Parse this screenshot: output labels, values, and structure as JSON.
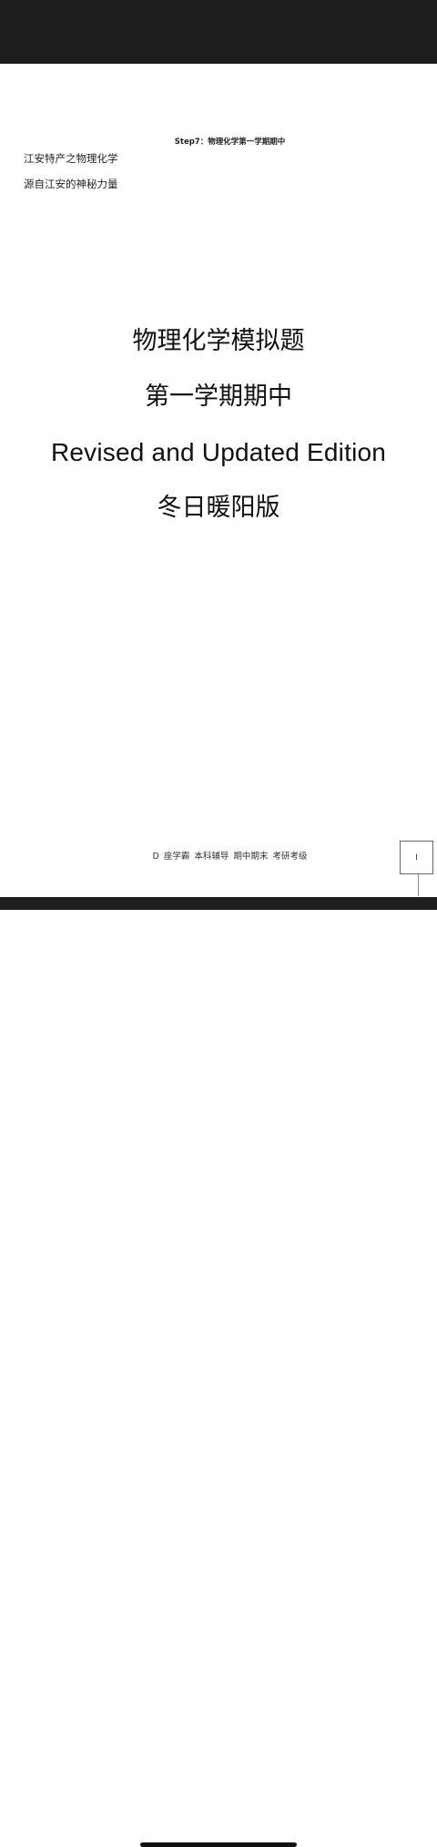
{
  "document": {
    "header": "Step7：物理化学第一学期期中",
    "side_note": {
      "line1": "江安特产之物理化学",
      "line2": "源自江安的神秘力量"
    },
    "title_lines": [
      "物理化学模拟题",
      "第一学期期中",
      "Revised and Updated Edition",
      "冬日暖阳版"
    ],
    "footer": "D 座学霸 本科辅导  期中期末 考研考级",
    "page_number": "I"
  },
  "colors": {
    "toolbar_background": "#1e1e1e",
    "page_background": "#ffffff",
    "text": "#111111"
  }
}
